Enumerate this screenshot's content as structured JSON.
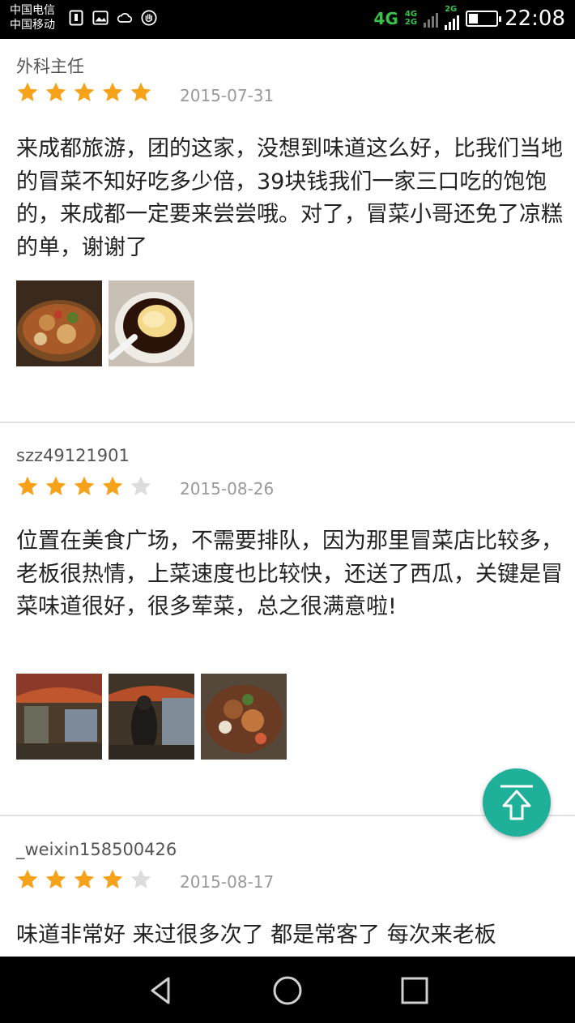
{
  "status_bar": {
    "carrier1": "中国电信",
    "carrier2": "中国移动",
    "network_main": "4G",
    "network_small_top": "4G",
    "network_small_bottom": "2G",
    "network_2g": "2G",
    "battery_level": 0.35,
    "time": "22:08"
  },
  "reviews": [
    {
      "user": "外科主任",
      "rating": 5,
      "date": "2015-07-31",
      "text": "来成都旅游，团的这家，没想到味道这么好，比我们当地的冒菜不知好吃多少倍，39块钱我们一家三口吃的饱饱的，来成都一定要来尝尝哦。对了，冒菜小哥还免了凉糕的单，谢谢了",
      "photos": [
        "hotpot-photo",
        "dessert-photo"
      ]
    },
    {
      "user": "szz49121901",
      "rating": 4,
      "date": "2015-08-26",
      "text": "位置在美食广场，不需要排队，因为那里冒菜店比较多，老板很热情，上菜速度也比较快，还送了西瓜，关键是冒菜味道很好，很多荤菜，总之很满意啦!",
      "photos": [
        "street-photo",
        "street-photo",
        "dish-photo"
      ]
    },
    {
      "user": "_weixin158500426",
      "rating": 4,
      "date": "2015-08-17",
      "text": "味道非常好 来过很多次了 都是常客了 每次来老板",
      "photos": []
    }
  ],
  "colors": {
    "star_on": "#f7a21b",
    "star_off": "#dcdcdc",
    "fab": "#1fb09a"
  },
  "fab_icon": "scroll-to-top-icon",
  "nav_icons": [
    "back-icon",
    "home-icon",
    "recents-icon"
  ]
}
